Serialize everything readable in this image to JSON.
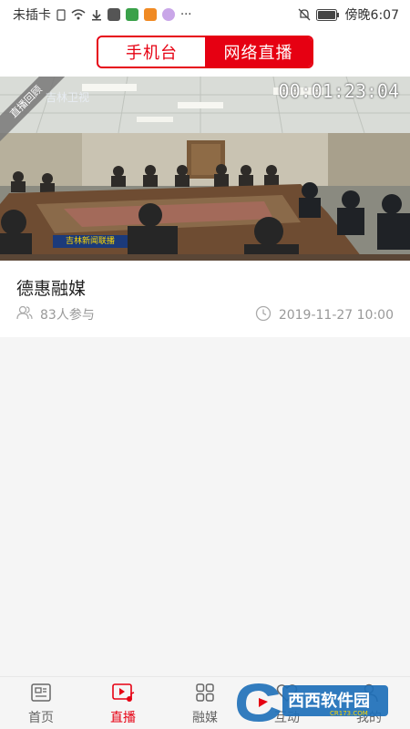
{
  "status_bar": {
    "carrier": "未插卡",
    "time": "傍晚6:07"
  },
  "header": {
    "tabs": [
      {
        "label": "手机台",
        "active": false
      },
      {
        "label": "网络直播",
        "active": true
      }
    ]
  },
  "card": {
    "ribbon": "直播回顾",
    "tv_logo": "吉林卫视",
    "timecode": "00:01:23:04",
    "caption_strip": "吉林新闻联播",
    "title": "德惠融媒",
    "participants": "83人参与",
    "datetime": "2019-11-27 10:00"
  },
  "bottom_nav": {
    "items": [
      {
        "label": "首页",
        "active": false
      },
      {
        "label": "直播",
        "active": true
      },
      {
        "label": "融媒",
        "active": false
      },
      {
        "label": "互动",
        "active": false
      },
      {
        "label": "我的",
        "active": false
      }
    ]
  },
  "watermark": {
    "text": "西西软件园",
    "sub": "CR173.COM"
  },
  "colors": {
    "accent": "#e60012",
    "muted": "#999999",
    "background": "#f5f5f5"
  }
}
